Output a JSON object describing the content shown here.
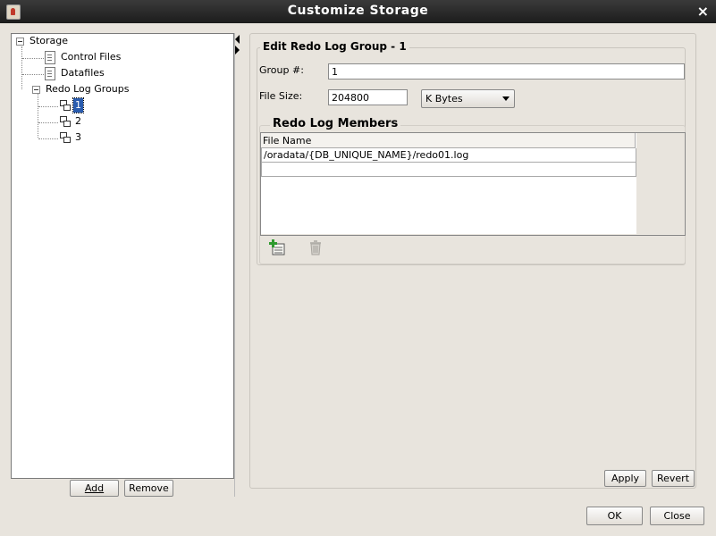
{
  "window": {
    "title": "Customize Storage"
  },
  "tree": {
    "root": "Storage",
    "items": [
      {
        "label": "Control Files"
      },
      {
        "label": "Datafiles"
      },
      {
        "label": "Redo Log Groups"
      }
    ],
    "groups": [
      "1",
      "2",
      "3"
    ]
  },
  "left_buttons": {
    "add": "Add",
    "remove": "Remove"
  },
  "edit": {
    "legend": "Edit Redo Log Group - 1",
    "group_label": "Group #:",
    "group_value": "1",
    "size_label": "File Size:",
    "size_value": "204800",
    "unit": "K Bytes"
  },
  "members": {
    "legend": "Redo Log Members",
    "column": "File Name",
    "rows": [
      "/oradata/{DB_UNIQUE_NAME}/redo01.log",
      ""
    ]
  },
  "panel_buttons": {
    "apply": "Apply",
    "revert": "Revert"
  },
  "dialog_buttons": {
    "ok": "OK",
    "close": "Close"
  },
  "colors": {
    "selection": "#2a5cae",
    "titlebar": "#2b2b2b"
  }
}
